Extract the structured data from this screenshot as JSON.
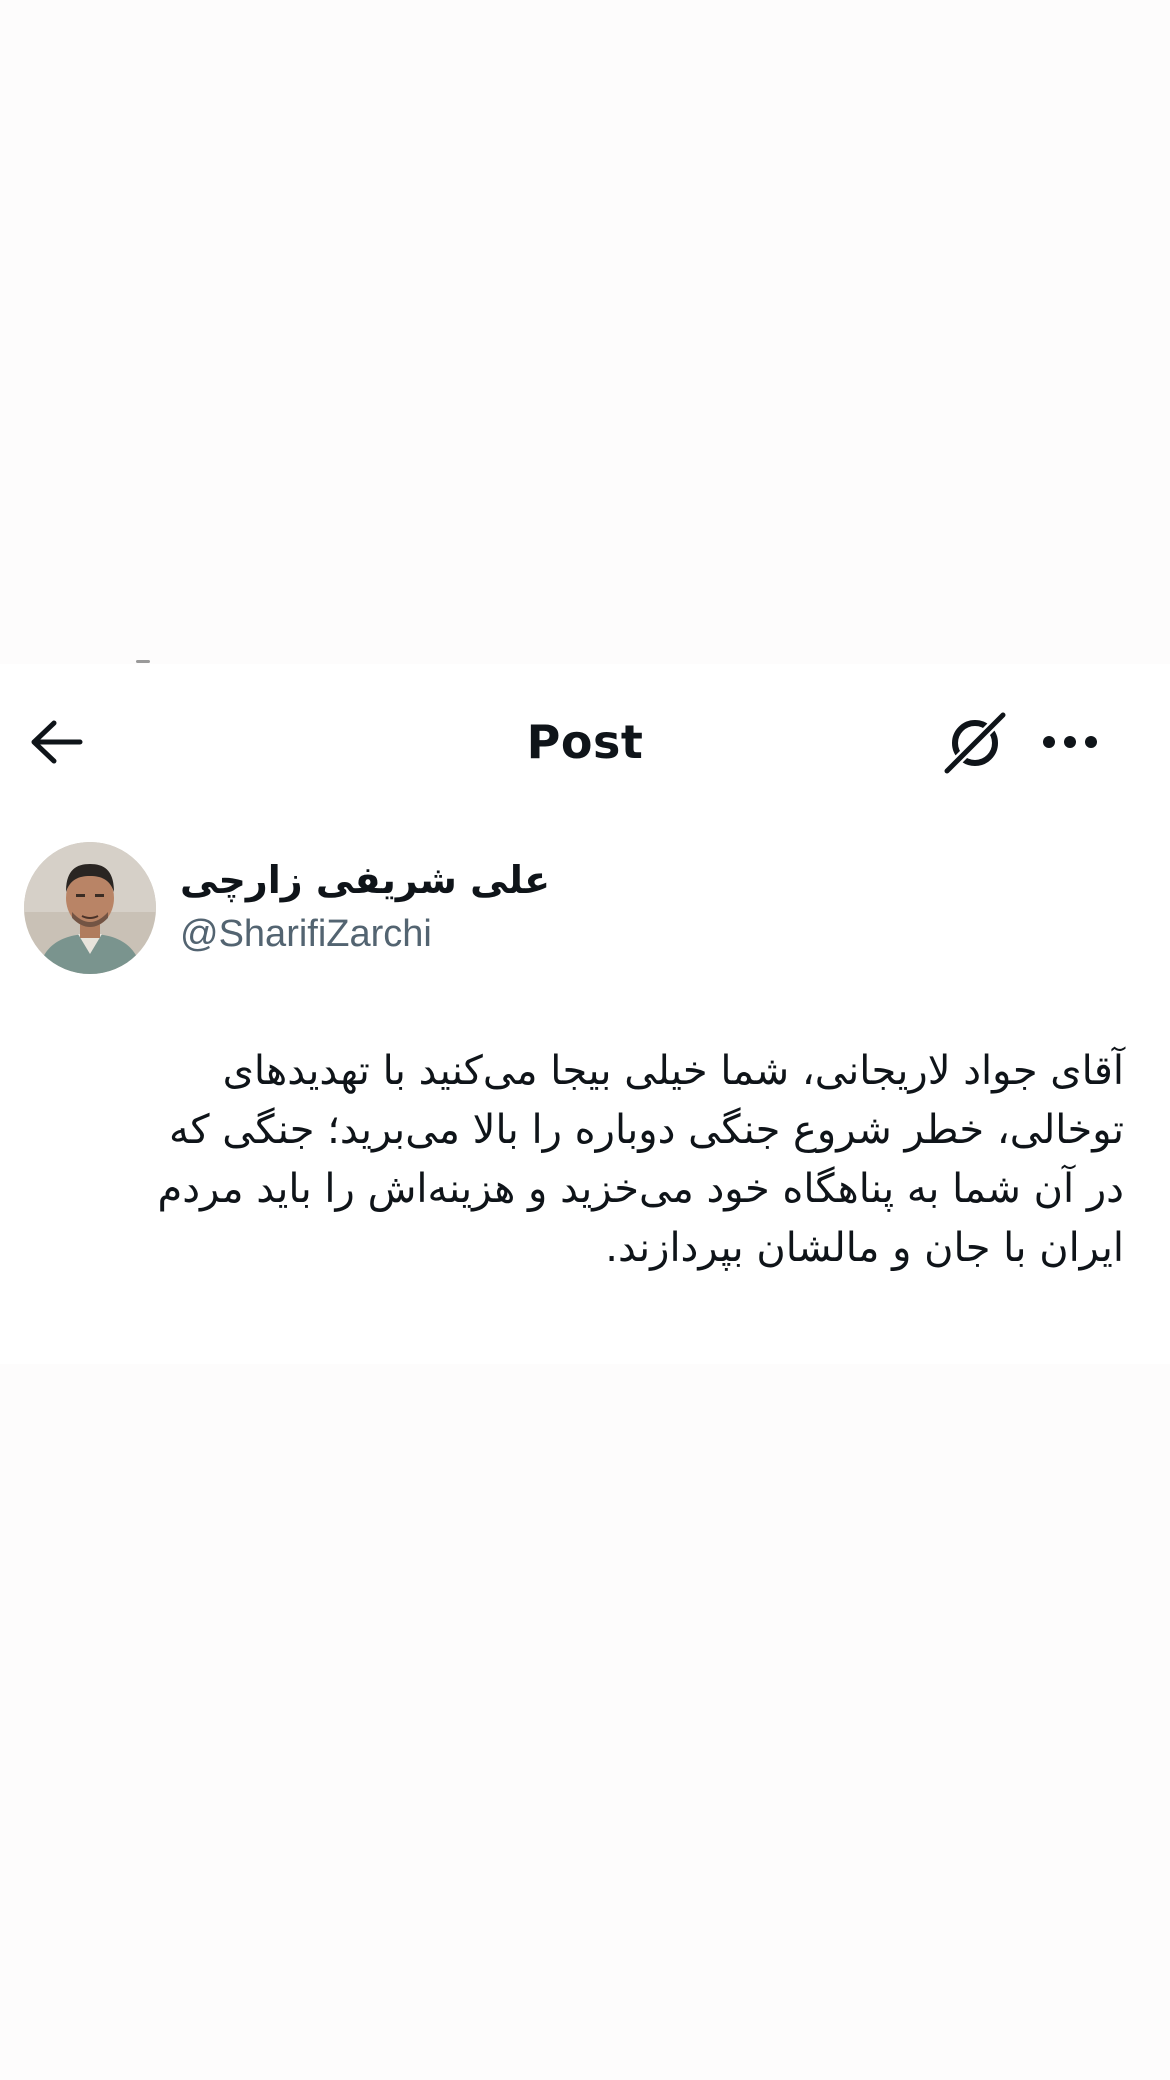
{
  "header": {
    "title": "Post",
    "icons": {
      "back": "arrow-left-icon",
      "grok": "grok-icon",
      "more": "more-horizontal-icon"
    }
  },
  "author": {
    "display_name": "علی شریفی زارچی",
    "handle": "@SharifiZarchi"
  },
  "tweet": {
    "text": "آقای جواد لاریجانی، شما خیلی بیجا می‌کنید با تهدیدهای\nتوخالی، خطر شروع جنگی دوباره را بالا می‌برید؛ جنگی که\nدر آن شما به پناهگاه خود می‌خزید و هزینه‌اش را باید مردم\nایران با جان و مالشان بپردازند."
  },
  "colors": {
    "text_primary": "#0f1419",
    "text_secondary": "#536471",
    "background": "#ffffff"
  }
}
